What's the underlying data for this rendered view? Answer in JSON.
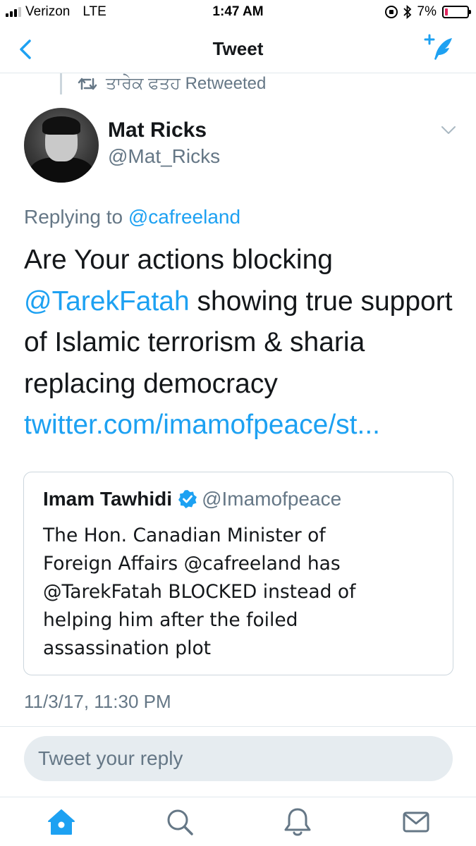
{
  "status_bar": {
    "carrier": "Verizon",
    "network": "LTE",
    "time": "1:47 AM",
    "battery": "7%",
    "battery_level": 0.07
  },
  "nav": {
    "title": "Tweet",
    "icons": [
      "back-chevron-icon",
      "compose-tweet-icon"
    ]
  },
  "retweet_context": {
    "text": "ਤਾਰੇਕ ਫਤਹ Retweeted",
    "icon": "retweet-icon"
  },
  "author": {
    "name": "Mat Ricks",
    "handle": "@Mat_Ricks"
  },
  "tweet": {
    "replying_prefix": "Replying to ",
    "replying_to": "@cafreeland",
    "line1": "Are Your actions blocking",
    "mention": "@TarekFatah",
    "line2_rest": " showing true support",
    "line3": "of Islamic terrorism & sharia",
    "line4": "replacing democracy",
    "link": "twitter.com/imamofpeace/st..."
  },
  "quote": {
    "name": "Imam Tawhidi",
    "handle": "@Imamofpeace",
    "lines": [
      "The Hon. Canadian Minister of",
      "Foreign Affairs @cafreeland has",
      "@TarekFatah BLOCKED instead of",
      "helping him after the foiled",
      "assassination plot"
    ]
  },
  "timestamp": "11/3/17, 11:30 PM",
  "reply_box": {
    "placeholder": "Tweet your reply"
  },
  "tab_bar": {
    "items": [
      "home-icon",
      "search-icon",
      "notifications-icon",
      "messages-icon"
    ],
    "active": "home-icon"
  },
  "colors": {
    "accent": "#1da1f2",
    "secondary_text": "#657786",
    "border": "#e1e8ed",
    "reply_bg": "#e6ecf0",
    "battery_low": "#e0245e"
  }
}
